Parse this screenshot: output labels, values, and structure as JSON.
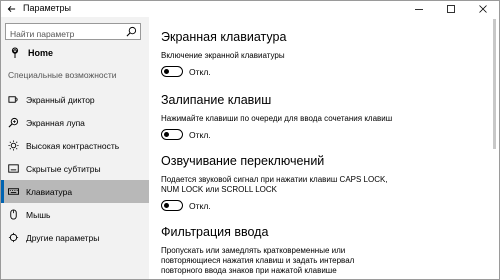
{
  "window": {
    "title": "Параметры"
  },
  "sidebar": {
    "search_placeholder": "Найти параметр",
    "home_label": "Home",
    "section_label": "Специальные возможности",
    "items": [
      {
        "label": "Экранный диктор",
        "icon": "narrator-icon"
      },
      {
        "label": "Экранная лупа",
        "icon": "magnifier-icon"
      },
      {
        "label": "Высокая контрастность",
        "icon": "contrast-icon"
      },
      {
        "label": "Скрытые субтитры",
        "icon": "captions-icon"
      },
      {
        "label": "Клавиатура",
        "icon": "keyboard-icon",
        "active": true
      },
      {
        "label": "Мышь",
        "icon": "mouse-icon"
      },
      {
        "label": "Другие параметры",
        "icon": "other-options-icon"
      }
    ]
  },
  "main": {
    "onscreen_keyboard": {
      "heading": "Экранная клавиатура",
      "description": "Включение экранной клавиатуры",
      "toggle_state": "Откл."
    },
    "sticky_keys": {
      "heading": "Залипание клавиш",
      "description": "Нажимайте клавиши по очереди для ввода сочетания клавиш",
      "toggle_state": "Откл."
    },
    "toggle_keys": {
      "heading": "Озвучивание переключений",
      "description_line1": "Подается звуковой сигнал при нажатии клавиш CAPS LOCK,",
      "description_line2": "NUM LOCK или SCROLL LOCK",
      "toggle_state": "Откл."
    },
    "filter_keys": {
      "heading": "Фильтрация ввода",
      "description_line1": "Пропускать или замедлять кратковременные или",
      "description_line2": "повторяющиеся нажатия клавиш и задать интервал",
      "description_line3": "повторного ввода знаков при нажатой клавише"
    }
  },
  "colors": {
    "accent": "#0063b1",
    "sidebar_bg": "#f2f2f2",
    "active_item_bg": "#b8b8b8"
  }
}
